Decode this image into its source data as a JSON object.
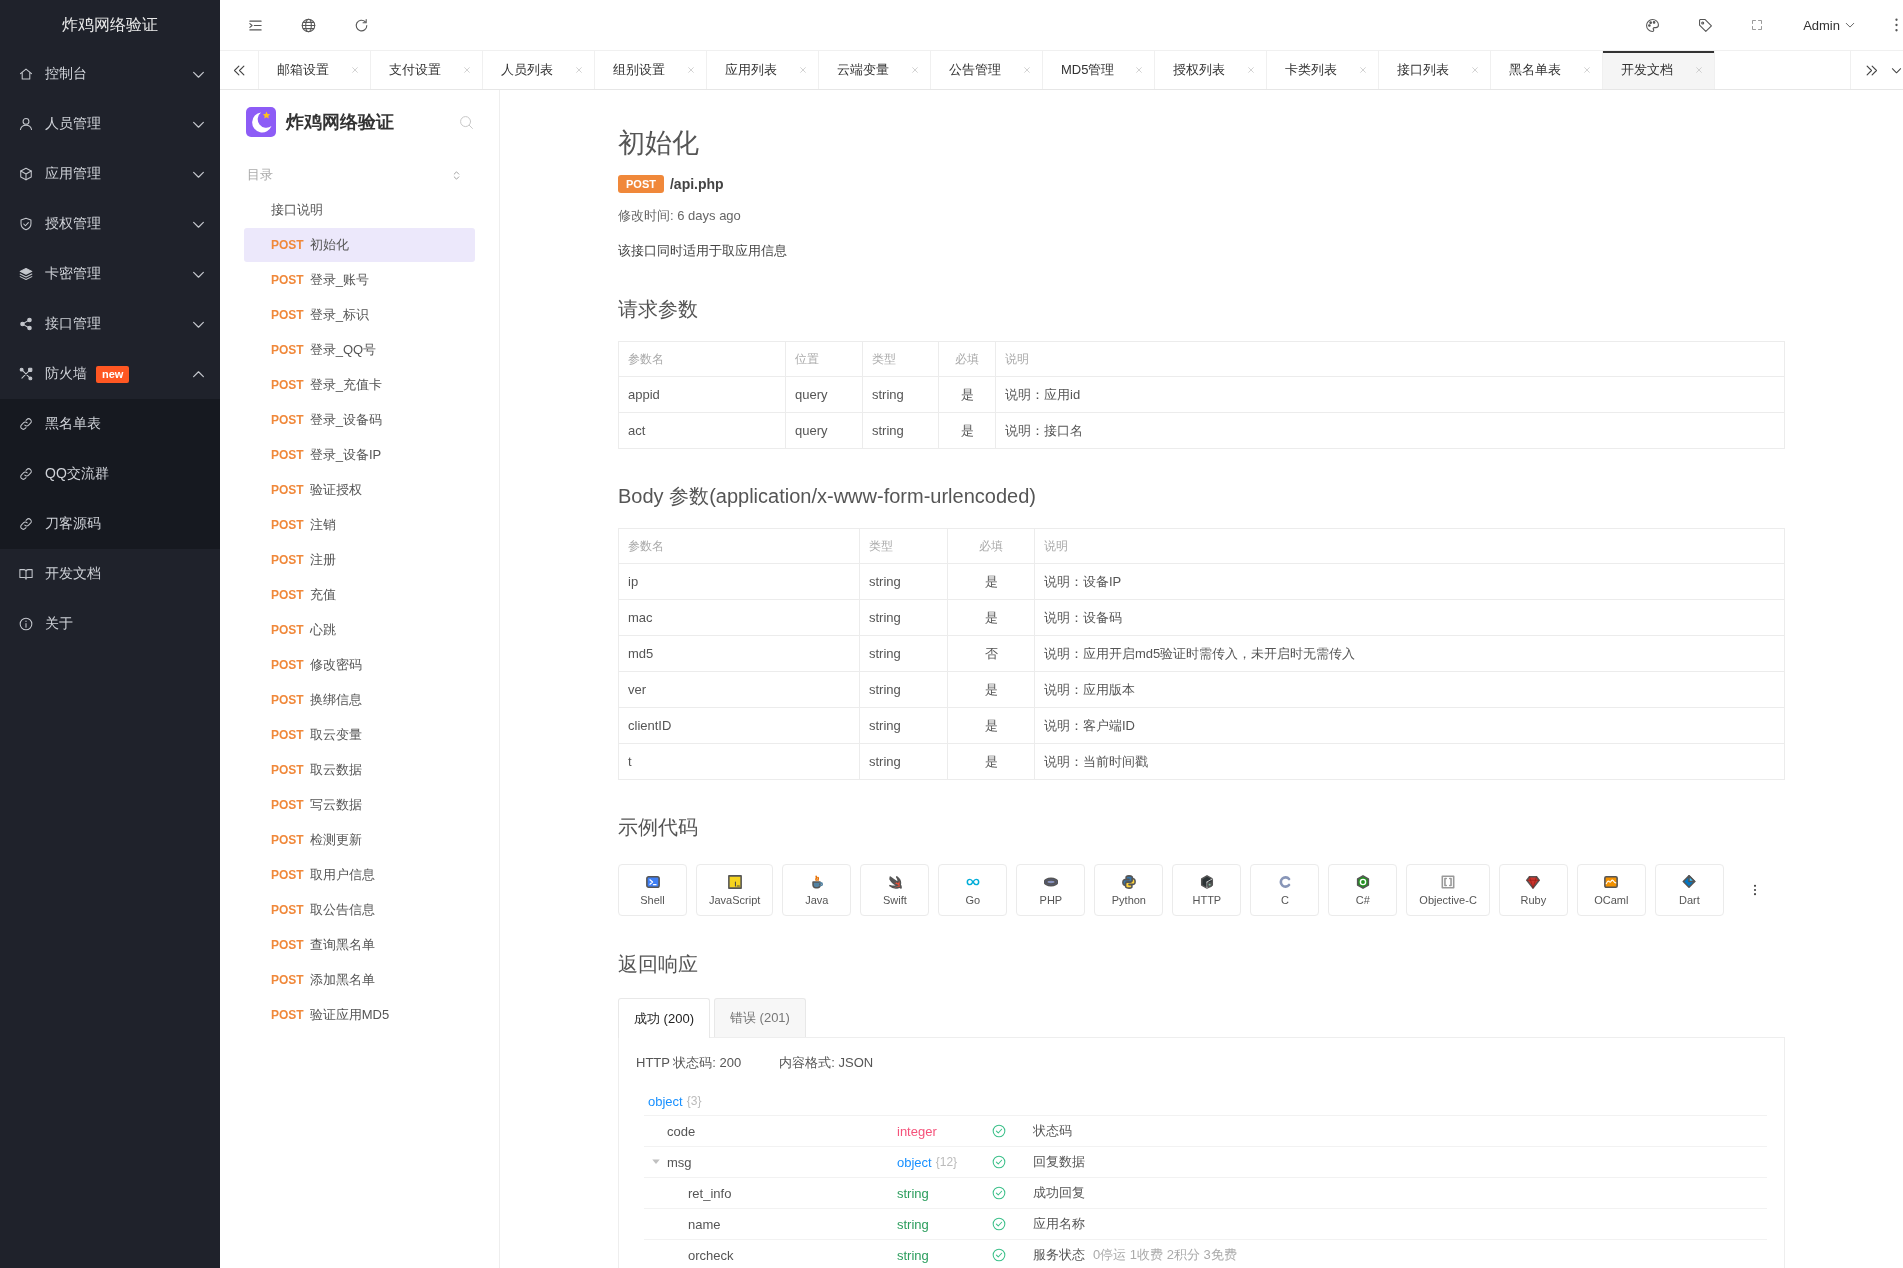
{
  "sidebar": {
    "title": "炸鸡网络验证",
    "items": [
      {
        "label": "控制台",
        "kind": "group",
        "expanded": false
      },
      {
        "label": "人员管理",
        "kind": "group",
        "expanded": false
      },
      {
        "label": "应用管理",
        "kind": "group",
        "expanded": false
      },
      {
        "label": "授权管理",
        "kind": "group",
        "expanded": false
      },
      {
        "label": "卡密管理",
        "kind": "group",
        "expanded": false
      },
      {
        "label": "接口管理",
        "kind": "group",
        "expanded": false
      },
      {
        "label": "防火墙",
        "kind": "group",
        "badge": "new",
        "expanded": true,
        "children": [
          {
            "label": "黑名单表"
          },
          {
            "label": "QQ交流群"
          },
          {
            "label": "刀客源码"
          }
        ]
      },
      {
        "label": "开发文档",
        "kind": "link"
      },
      {
        "label": "关于",
        "kind": "link"
      }
    ]
  },
  "header": {
    "user": "Admin"
  },
  "tabs": [
    {
      "label": "邮箱设置",
      "selected": false
    },
    {
      "label": "支付设置",
      "selected": false
    },
    {
      "label": "人员列表",
      "selected": false
    },
    {
      "label": "组别设置",
      "selected": false
    },
    {
      "label": "应用列表",
      "selected": false
    },
    {
      "label": "云端变量",
      "selected": false
    },
    {
      "label": "公告管理",
      "selected": false
    },
    {
      "label": "MD5管理",
      "selected": false
    },
    {
      "label": "授权列表",
      "selected": false
    },
    {
      "label": "卡类列表",
      "selected": false
    },
    {
      "label": "接口列表",
      "selected": false
    },
    {
      "label": "黑名单表",
      "selected": false
    },
    {
      "label": "开发文档",
      "selected": true
    }
  ],
  "doc_nav": {
    "brand": "炸鸡网络验证",
    "toc_label": "目录",
    "items": [
      {
        "label": "接口说明",
        "selected": false
      },
      {
        "method": "POST",
        "label": "初始化",
        "selected": true
      },
      {
        "method": "POST",
        "label": "登录_账号",
        "selected": false
      },
      {
        "method": "POST",
        "label": "登录_标识",
        "selected": false
      },
      {
        "method": "POST",
        "label": "登录_QQ号",
        "selected": false
      },
      {
        "method": "POST",
        "label": "登录_充值卡",
        "selected": false
      },
      {
        "method": "POST",
        "label": "登录_设备码",
        "selected": false
      },
      {
        "method": "POST",
        "label": "登录_设备IP",
        "selected": false
      },
      {
        "method": "POST",
        "label": "验证授权",
        "selected": false
      },
      {
        "method": "POST",
        "label": "注销",
        "selected": false
      },
      {
        "method": "POST",
        "label": "注册",
        "selected": false
      },
      {
        "method": "POST",
        "label": "充值",
        "selected": false
      },
      {
        "method": "POST",
        "label": "心跳",
        "selected": false
      },
      {
        "method": "POST",
        "label": "修改密码",
        "selected": false
      },
      {
        "method": "POST",
        "label": "换绑信息",
        "selected": false
      },
      {
        "method": "POST",
        "label": "取云变量",
        "selected": false
      },
      {
        "method": "POST",
        "label": "取云数据",
        "selected": false
      },
      {
        "method": "POST",
        "label": "写云数据",
        "selected": false
      },
      {
        "method": "POST",
        "label": "检测更新",
        "selected": false
      },
      {
        "method": "POST",
        "label": "取用户信息",
        "selected": false
      },
      {
        "method": "POST",
        "label": "取公告信息",
        "selected": false
      },
      {
        "method": "POST",
        "label": "查询黑名单",
        "selected": false
      },
      {
        "method": "POST",
        "label": "添加黑名单",
        "selected": false
      },
      {
        "method": "POST",
        "label": "验证应用MD5",
        "selected": false
      }
    ]
  },
  "doc": {
    "title": "初始化",
    "method": "POST",
    "path": "/api.php",
    "modified": "修改时间: 6 days ago",
    "description": "该接口同时适用于取应用信息",
    "request_params": {
      "heading": "请求参数",
      "columns": [
        "参数名",
        "位置",
        "类型",
        "必填",
        "说明"
      ],
      "rows": [
        [
          "appid",
          "query",
          "string",
          "是",
          "说明：应用id"
        ],
        [
          "act",
          "query",
          "string",
          "是",
          "说明：接口名"
        ]
      ]
    },
    "body_params": {
      "heading": "Body 参数(application/x-www-form-urlencoded)",
      "columns": [
        "参数名",
        "类型",
        "必填",
        "说明"
      ],
      "rows": [
        [
          "ip",
          "string",
          "是",
          "说明：设备IP"
        ],
        [
          "mac",
          "string",
          "是",
          "说明：设备码"
        ],
        [
          "md5",
          "string",
          "否",
          "说明：应用开启md5验证时需传入，未开启时无需传入"
        ],
        [
          "ver",
          "string",
          "是",
          "说明：应用版本"
        ],
        [
          "clientID",
          "string",
          "是",
          "说明：客户端ID"
        ],
        [
          "t",
          "string",
          "是",
          "说明：当前时间戳"
        ]
      ]
    },
    "examples": {
      "heading": "示例代码",
      "languages": [
        "Shell",
        "JavaScript",
        "Java",
        "Swift",
        "Go",
        "PHP",
        "Python",
        "HTTP",
        "C",
        "C#",
        "Objective-C",
        "Ruby",
        "OCaml",
        "Dart"
      ]
    },
    "response": {
      "heading": "返回响应",
      "tabs": [
        {
          "label": "成功 (200)",
          "selected": true
        },
        {
          "label": "错误 (201)",
          "selected": false
        }
      ],
      "status": "HTTP 状态码: 200",
      "format": "内容格式: JSON",
      "schema": {
        "type": "object",
        "count": "{3}",
        "color": "#1890ff",
        "children": [
          {
            "name": "code",
            "type": "integer",
            "color": "#f5527a",
            "required": true,
            "description": "状态码"
          },
          {
            "name": "msg",
            "type": "object",
            "count": "{12}",
            "color": "#1890ff",
            "required": true,
            "description": "回复数据",
            "expanded": true,
            "children": [
              {
                "name": "ret_info",
                "type": "string",
                "color": "#2a9d5c",
                "required": true,
                "description": "成功回复"
              },
              {
                "name": "name",
                "type": "string",
                "color": "#2a9d5c",
                "required": true,
                "description": "应用名称"
              },
              {
                "name": "orcheck",
                "type": "string",
                "color": "#2a9d5c",
                "required": true,
                "description": "服务状态",
                "note": "0停运 1收费 2积分 3免费"
              }
            ]
          }
        ]
      }
    }
  }
}
